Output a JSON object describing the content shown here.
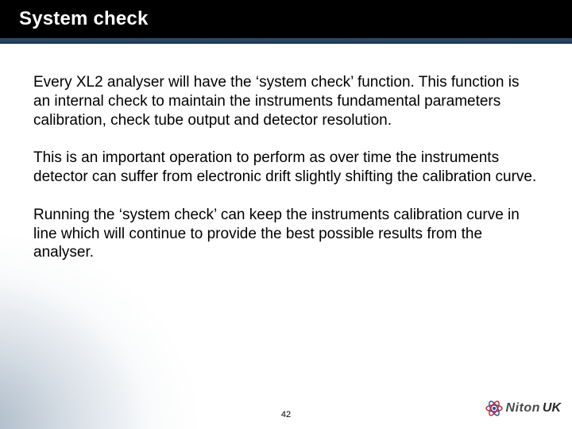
{
  "title": "System check",
  "paragraphs": [
    "Every XL2 analyser will have the ‘system check’ function. This function is an internal check to maintain the instruments fundamental parameters calibration, check tube output and detector resolution.",
    "This is an important operation to perform as over time the instruments detector can suffer from electronic drift slightly shifting the calibration curve.",
    "Running the ‘system check’ can keep the instruments calibration curve in line which will continue to provide the best possible results from the analyser."
  ],
  "page_number": "42",
  "logo": {
    "brand": "Niton",
    "suffix": "UK",
    "icon": "atom-icon"
  },
  "colors": {
    "title_bg": "#000000",
    "accent_bar": "#2d4a6b",
    "atom_red": "#c0222f",
    "atom_blue": "#1f4fa0"
  }
}
